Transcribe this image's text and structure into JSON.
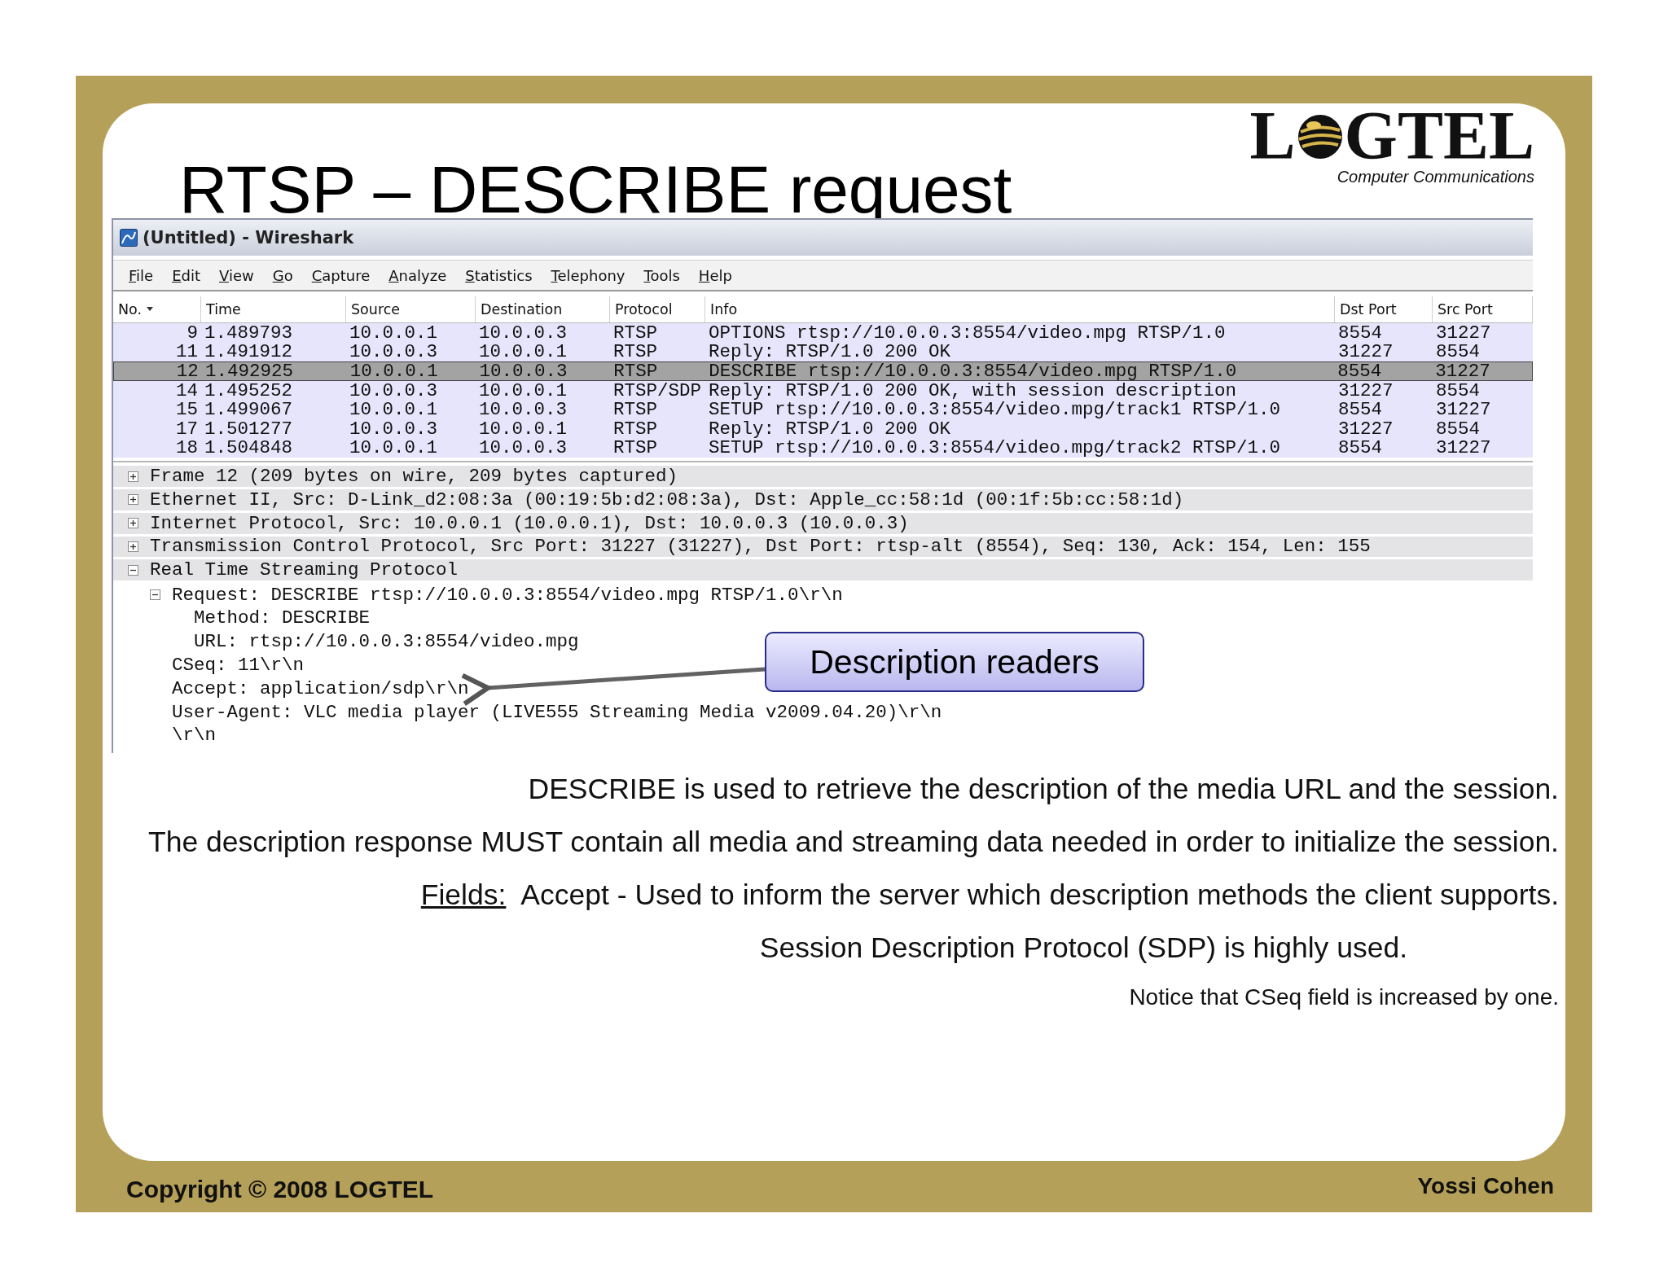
{
  "slide": {
    "title": "RTSP – DESCRIBE request",
    "logo": {
      "before": "L",
      "after": "GTEL",
      "tagline": "Computer Communications"
    }
  },
  "window": {
    "title": "(Untitled) - Wireshark"
  },
  "menu": [
    "File",
    "Edit",
    "View",
    "Go",
    "Capture",
    "Analyze",
    "Statistics",
    "Telephony",
    "Tools",
    "Help"
  ],
  "packet_list": {
    "columns": [
      {
        "label": "No.",
        "sorted": true
      },
      {
        "label": "Time",
        "sorted": false
      },
      {
        "label": "Source",
        "sorted": false
      },
      {
        "label": "Destination",
        "sorted": false
      },
      {
        "label": "Protocol",
        "sorted": false
      },
      {
        "label": "Info",
        "sorted": false
      },
      {
        "label": "Dst Port",
        "sorted": false
      },
      {
        "label": "Src Port",
        "sorted": false
      }
    ],
    "rows": [
      {
        "selected": false,
        "cells": [
          "9",
          "1.489793",
          "10.0.0.1",
          "10.0.0.3",
          "RTSP",
          "OPTIONS rtsp://10.0.0.3:8554/video.mpg RTSP/1.0",
          "8554",
          "31227"
        ]
      },
      {
        "selected": false,
        "cells": [
          "11",
          "1.491912",
          "10.0.0.3",
          "10.0.0.1",
          "RTSP",
          "Reply: RTSP/1.0 200 OK",
          "31227",
          "8554"
        ]
      },
      {
        "selected": true,
        "cells": [
          "12",
          "1.492925",
          "10.0.0.1",
          "10.0.0.3",
          "RTSP",
          "DESCRIBE rtsp://10.0.0.3:8554/video.mpg RTSP/1.0",
          "8554",
          "31227"
        ]
      },
      {
        "selected": false,
        "cells": [
          "14",
          "1.495252",
          "10.0.0.3",
          "10.0.0.1",
          "RTSP/SDP",
          "Reply: RTSP/1.0 200 OK, with session description",
          "31227",
          "8554"
        ]
      },
      {
        "selected": false,
        "cells": [
          "15",
          "1.499067",
          "10.0.0.1",
          "10.0.0.3",
          "RTSP",
          "SETUP rtsp://10.0.0.3:8554/video.mpg/track1 RTSP/1.0",
          "8554",
          "31227"
        ]
      },
      {
        "selected": false,
        "cells": [
          "17",
          "1.501277",
          "10.0.0.3",
          "10.0.0.1",
          "RTSP",
          "Reply: RTSP/1.0 200 OK",
          "31227",
          "8554"
        ]
      },
      {
        "selected": false,
        "cells": [
          "18",
          "1.504848",
          "10.0.0.1",
          "10.0.0.3",
          "RTSP",
          "SETUP rtsp://10.0.0.3:8554/video.mpg/track2 RTSP/1.0",
          "8554",
          "31227"
        ]
      }
    ]
  },
  "packet_details": [
    {
      "text": "Frame 12 (209 bytes on wire, 209 bytes captured)",
      "expanded": false
    },
    {
      "text": "Ethernet II, Src: D-Link_d2:08:3a (00:19:5b:d2:08:3a), Dst: Apple_cc:58:1d (00:1f:5b:cc:58:1d)",
      "expanded": false
    },
    {
      "text": "Internet Protocol, Src: 10.0.0.1 (10.0.0.1), Dst: 10.0.0.3 (10.0.0.3)",
      "expanded": false
    },
    {
      "text": "Transmission Control Protocol, Src Port: 31227 (31227), Dst Port: rtsp-alt (8554), Seq: 130, Ack: 154, Len: 155",
      "expanded": false
    },
    {
      "text": "Real Time Streaming Protocol",
      "expanded": true,
      "children": [
        {
          "text": "Request: DESCRIBE rtsp://10.0.0.3:8554/video.mpg RTSP/1.0\\r\\n",
          "expanded": true,
          "children": [
            {
              "text": "Method: DESCRIBE"
            },
            {
              "text": "URL: rtsp://10.0.0.3:8554/video.mpg"
            }
          ]
        },
        {
          "text": "CSeq: 11\\r\\n"
        },
        {
          "text": "Accept: application/sdp\\r\\n"
        },
        {
          "text": "User-Agent: VLC media player (LIVE555 Streaming Media v2009.04.20)\\r\\n"
        },
        {
          "text": "\\r\\n"
        }
      ]
    }
  ],
  "callout": {
    "text": "Description readers"
  },
  "body_text": [
    {
      "kind": "line",
      "text": "DESCRIBE is used to retrieve the description of the media URL and the session."
    },
    {
      "kind": "line",
      "text": "The description response MUST contain all media and streaming data needed in order to initialize the session."
    },
    {
      "kind": "fields",
      "label": "Fields:",
      "text": "Accept - Used to inform the server which description methods the client supports."
    },
    {
      "kind": "sub",
      "text": "Session Description Protocol (SDP) is highly used."
    },
    {
      "kind": "note",
      "text": "Notice that CSeq field is increased by one."
    }
  ],
  "footer": {
    "copyright": "Copyright © 2008 LOGTEL",
    "author": "Yossi Cohen"
  }
}
